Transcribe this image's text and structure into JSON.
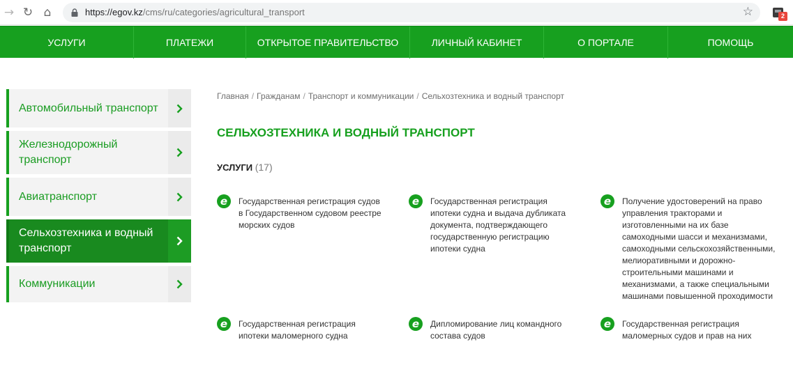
{
  "browser": {
    "url_host": "https://egov.kz",
    "url_path": "/cms/ru/categories/agricultural_transport",
    "extension_badge": "2",
    "icons": [
      "back-icon",
      "reload-icon",
      "home-icon",
      "lock-icon",
      "star-icon",
      "extension-icon"
    ]
  },
  "menu": {
    "items": [
      {
        "label": "УСЛУГИ"
      },
      {
        "label": "ПЛАТЕЖИ"
      },
      {
        "label": "ОТКРЫТОЕ ПРАВИТЕЛЬСТВО"
      },
      {
        "label": "ЛИЧНЫЙ КАБИНЕТ"
      },
      {
        "label": "О ПОРТАЛЕ"
      },
      {
        "label": "ПОМОЩЬ"
      }
    ]
  },
  "sidebar": {
    "items": [
      {
        "label": "Автомобильный транспорт",
        "active": false
      },
      {
        "label": "Железнодорожный транспорт",
        "active": false
      },
      {
        "label": "Авиатранспорт",
        "active": false
      },
      {
        "label": "Сельхозтехника и водный транспорт",
        "active": true
      },
      {
        "label": "Коммуникации",
        "active": false
      }
    ]
  },
  "breadcrumb": [
    "Главная",
    "Гражданам",
    "Транспорт и коммуникации",
    "Сельхозтехника и водный транспорт"
  ],
  "page_title": "СЕЛЬХОЗТЕХНИКА И ВОДНЫЙ ТРАНСПОРТ",
  "services": {
    "label": "УСЛУГИ",
    "count": "(17)",
    "icon_letter": "e",
    "items": [
      {
        "text": "Государственная регистрация судов в Государственном судовом реестре морских судов"
      },
      {
        "text": "Государственная регистрация ипотеки судна и выдача дубликата документа, подтверждающего государственную регистрацию ипотеки судна"
      },
      {
        "text": "Получение удостоверений на право управления тракторами и изготовленными на их базе самоходными шасси и механизмами, самоходными сельскохозяйственными, мелиоративными и дорожно-строительными машинами и механизмами, а также специальными машинами повышенной проходимости"
      },
      {
        "text": "Государственная регистрация ипотеки маломерного судна"
      },
      {
        "text": "Дипломирование лиц командного состава судов"
      },
      {
        "text": "Государственная регистрация маломерных судов и прав на них"
      }
    ]
  },
  "colors": {
    "brand_green": "#17a01f",
    "active_green": "#198a1f",
    "sidebar_bg": "#f3f3f3"
  }
}
